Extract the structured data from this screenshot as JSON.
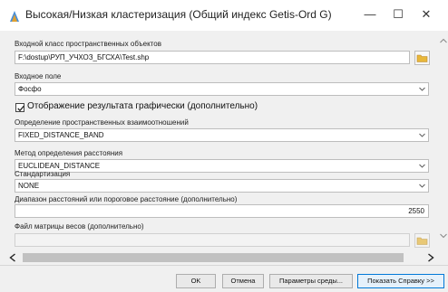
{
  "window": {
    "title": "Высокая/Низкая кластеризация (Общий индекс Getis-Ord G)",
    "minimize": "—",
    "maximize": "☐",
    "close": "✕"
  },
  "form": {
    "input_class_label": "Входной класс пространственных объектов",
    "input_class_value": "F:\\dostup\\РУП_УЧХОЗ_БГСХА\\Test.shp",
    "input_field_label": "Входное поле",
    "input_field_value": "Фосфо",
    "graphic_output_label": "Отображение результата графически (дополнительно)",
    "spatial_rel_label": "Определение пространственных взаимоотношений",
    "spatial_rel_value": "FIXED_DISTANCE_BAND",
    "distance_method_label": "Метод определения расстояния",
    "distance_method_value": "EUCLIDEAN_DISTANCE",
    "standardization_label": "Стандартизация",
    "standardization_value": "NONE",
    "distance_band_label": "Диапазон расстояний или пороговое расстояние (дополнительно)",
    "distance_band_value": "2550",
    "weights_file_label": "Файл матрицы весов (дополнительно)",
    "weights_file_value": ""
  },
  "buttons": {
    "ok": "OK",
    "cancel": "Отмена",
    "environments": "Параметры среды...",
    "show_help": "Показать Справку >>"
  },
  "colors": {
    "accent": "#0078d7",
    "folder": "#e8b73a"
  }
}
